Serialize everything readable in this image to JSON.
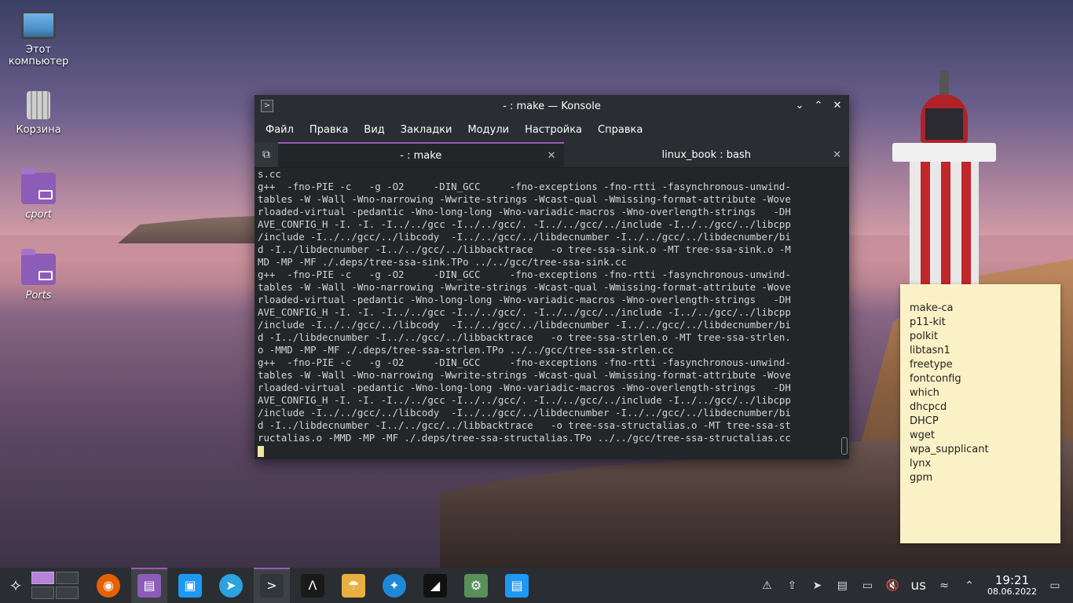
{
  "desktop": {
    "icons": [
      {
        "label": "Этот компьютер",
        "icon": "computer-icon"
      },
      {
        "label": "Корзина",
        "icon": "trash-icon"
      },
      {
        "label": "cport",
        "icon": "folder-link-icon"
      },
      {
        "label": "Ports",
        "icon": "folder-link-icon"
      }
    ]
  },
  "konsole": {
    "title": "- : make — Konsole",
    "menu": [
      "Файл",
      "Правка",
      "Вид",
      "Закладки",
      "Модули",
      "Настройка",
      "Справка"
    ],
    "tabs": [
      {
        "label": "- : make",
        "active": true
      },
      {
        "label": "linux_book : bash",
        "active": false
      }
    ],
    "terminal_lines": [
      "s.cc",
      "g++  -fno-PIE -c   -g -O2     -DIN_GCC     -fno-exceptions -fno-rtti -fasynchronous-unwind-",
      "tables -W -Wall -Wno-narrowing -Wwrite-strings -Wcast-qual -Wmissing-format-attribute -Wove",
      "rloaded-virtual -pedantic -Wno-long-long -Wno-variadic-macros -Wno-overlength-strings   -DH",
      "AVE_CONFIG_H -I. -I. -I../../gcc -I../../gcc/. -I../../gcc/../include -I../../gcc/../libcpp",
      "/include -I../../gcc/../libcody  -I../../gcc/../libdecnumber -I../../gcc/../libdecnumber/bi",
      "d -I../libdecnumber -I../../gcc/../libbacktrace   -o tree-ssa-sink.o -MT tree-ssa-sink.o -M",
      "MD -MP -MF ./.deps/tree-ssa-sink.TPo ../../gcc/tree-ssa-sink.cc",
      "g++  -fno-PIE -c   -g -O2     -DIN_GCC     -fno-exceptions -fno-rtti -fasynchronous-unwind-",
      "tables -W -Wall -Wno-narrowing -Wwrite-strings -Wcast-qual -Wmissing-format-attribute -Wove",
      "rloaded-virtual -pedantic -Wno-long-long -Wno-variadic-macros -Wno-overlength-strings   -DH",
      "AVE_CONFIG_H -I. -I. -I../../gcc -I../../gcc/. -I../../gcc/../include -I../../gcc/../libcpp",
      "/include -I../../gcc/../libcody  -I../../gcc/../libdecnumber -I../../gcc/../libdecnumber/bi",
      "d -I../libdecnumber -I../../gcc/../libbacktrace   -o tree-ssa-strlen.o -MT tree-ssa-strlen.",
      "o -MMD -MP -MF ./.deps/tree-ssa-strlen.TPo ../../gcc/tree-ssa-strlen.cc",
      "g++  -fno-PIE -c   -g -O2     -DIN_GCC     -fno-exceptions -fno-rtti -fasynchronous-unwind-",
      "tables -W -Wall -Wno-narrowing -Wwrite-strings -Wcast-qual -Wmissing-format-attribute -Wove",
      "rloaded-virtual -pedantic -Wno-long-long -Wno-variadic-macros -Wno-overlength-strings   -DH",
      "AVE_CONFIG_H -I. -I. -I../../gcc -I../../gcc/. -I../../gcc/../include -I../../gcc/../libcpp",
      "/include -I../../gcc/../libcody  -I../../gcc/../libdecnumber -I../../gcc/../libdecnumber/bi",
      "d -I../libdecnumber -I../../gcc/../libbacktrace   -o tree-ssa-structalias.o -MT tree-ssa-st",
      "ructalias.o -MMD -MP -MF ./.deps/tree-ssa-structalias.TPo ../../gcc/tree-ssa-structalias.cc"
    ]
  },
  "sticky_note": {
    "items": [
      "make-ca",
      "p11-kit",
      "polkit",
      "libtasn1",
      "freetype",
      "fontconfig",
      "which",
      "dhcpcd",
      "DHCP",
      "wget",
      "wpa_supplicant",
      "lynx",
      "gpm"
    ]
  },
  "taskbar": {
    "apps": [
      {
        "name": "firefox-icon",
        "active": false,
        "color": "#e66000"
      },
      {
        "name": "file-manager-icon",
        "active": true,
        "color": "#8d5bb8"
      },
      {
        "name": "store-icon",
        "active": false,
        "color": "#1d99f3"
      },
      {
        "name": "telegram-icon",
        "active": false,
        "color": "#2aa3df"
      },
      {
        "name": "konsole-icon",
        "active": true,
        "color": "#31363b"
      },
      {
        "name": "app-launcher-icon",
        "active": false,
        "color": "#1a1a1a"
      },
      {
        "name": "app-umbrella-icon",
        "active": false,
        "color": "#e8b040"
      },
      {
        "name": "browser-icon",
        "active": false,
        "color": "#1e88d8"
      },
      {
        "name": "app-red-icon",
        "active": false,
        "color": "#111111"
      },
      {
        "name": "settings-icon",
        "active": false,
        "color": "#5a8f5a"
      },
      {
        "name": "document-icon",
        "active": false,
        "color": "#1d99f3"
      }
    ],
    "keyboard_layout": "us",
    "time": "19:21",
    "date": "08.06.2022"
  },
  "colors": {
    "accent": "#9b59b6",
    "sticky": "#fbf1c6",
    "terminal_bg": "#232629"
  }
}
